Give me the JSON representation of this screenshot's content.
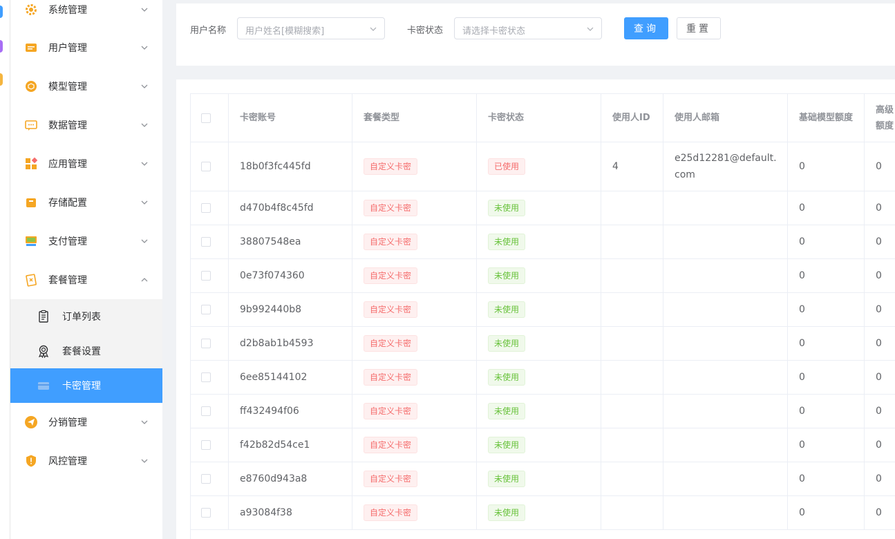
{
  "colors": {
    "primary": "#409eff",
    "danger": "#f56c6c",
    "success": "#67c23a",
    "warning": "#f5a623"
  },
  "sidebar": {
    "items": [
      {
        "label": "系统管理",
        "icon": "gear-icon"
      },
      {
        "label": "用户管理",
        "icon": "user-card-icon"
      },
      {
        "label": "模型管理",
        "icon": "cube-icon"
      },
      {
        "label": "数据管理",
        "icon": "chat-data-icon"
      },
      {
        "label": "应用管理",
        "icon": "apps-grid-icon"
      },
      {
        "label": "存储配置",
        "icon": "storage-box-icon"
      },
      {
        "label": "支付管理",
        "icon": "payment-board-icon"
      },
      {
        "label": "套餐管理",
        "icon": "package-cards-icon"
      }
    ],
    "submenu": [
      {
        "label": "订单列表",
        "icon": "order-list-icon"
      },
      {
        "label": "套餐设置",
        "icon": "award-badge-icon"
      },
      {
        "label": "卡密管理",
        "icon": "card-icon"
      }
    ],
    "bottom_items": [
      {
        "label": "分销管理",
        "icon": "paper-plane-icon"
      },
      {
        "label": "风控管理",
        "icon": "shield-alert-icon"
      }
    ]
  },
  "search": {
    "username_label": "用户名称",
    "username_placeholder": "用户姓名[模糊搜索]",
    "status_label": "卡密状态",
    "status_placeholder": "请选择卡密状态",
    "query_button": "查询",
    "reset_button": "重置"
  },
  "table": {
    "headers": {
      "code": "卡密账号",
      "package_type": "套餐类型",
      "status": "卡密状态",
      "user_id": "使用人ID",
      "user_email": "使用人邮箱",
      "base_quota": "基础模型额度",
      "adv_quota": "高级额度"
    },
    "rows": [
      {
        "code": "18b0f3fc445fd",
        "type": "自定义卡密",
        "status": "已使用",
        "status_kind": "used",
        "user_id": "4",
        "email": "e25d12281@default.com",
        "base": "0",
        "adv": "0"
      },
      {
        "code": "d470b4f8c45fd",
        "type": "自定义卡密",
        "status": "未使用",
        "status_kind": "unused",
        "user_id": "",
        "email": "",
        "base": "0",
        "adv": "0"
      },
      {
        "code": "38807548ea",
        "type": "自定义卡密",
        "status": "未使用",
        "status_kind": "unused",
        "user_id": "",
        "email": "",
        "base": "0",
        "adv": "0"
      },
      {
        "code": "0e73f074360",
        "type": "自定义卡密",
        "status": "未使用",
        "status_kind": "unused",
        "user_id": "",
        "email": "",
        "base": "0",
        "adv": "0"
      },
      {
        "code": "9b992440b8",
        "type": "自定义卡密",
        "status": "未使用",
        "status_kind": "unused",
        "user_id": "",
        "email": "",
        "base": "0",
        "adv": "0"
      },
      {
        "code": "d2b8ab1b4593",
        "type": "自定义卡密",
        "status": "未使用",
        "status_kind": "unused",
        "user_id": "",
        "email": "",
        "base": "0",
        "adv": "0"
      },
      {
        "code": "6ee85144102",
        "type": "自定义卡密",
        "status": "未使用",
        "status_kind": "unused",
        "user_id": "",
        "email": "",
        "base": "0",
        "adv": "0"
      },
      {
        "code": "ff432494f06",
        "type": "自定义卡密",
        "status": "未使用",
        "status_kind": "unused",
        "user_id": "",
        "email": "",
        "base": "0",
        "adv": "0"
      },
      {
        "code": "f42b82d54ce1",
        "type": "自定义卡密",
        "status": "未使用",
        "status_kind": "unused",
        "user_id": "",
        "email": "",
        "base": "0",
        "adv": "0"
      },
      {
        "code": "e8760d943a8",
        "type": "自定义卡密",
        "status": "未使用",
        "status_kind": "unused",
        "user_id": "",
        "email": "",
        "base": "0",
        "adv": "0"
      },
      {
        "code": "a93084f38",
        "type": "自定义卡密",
        "status": "未使用",
        "status_kind": "unused",
        "user_id": "",
        "email": "",
        "base": "0",
        "adv": "0"
      }
    ]
  }
}
